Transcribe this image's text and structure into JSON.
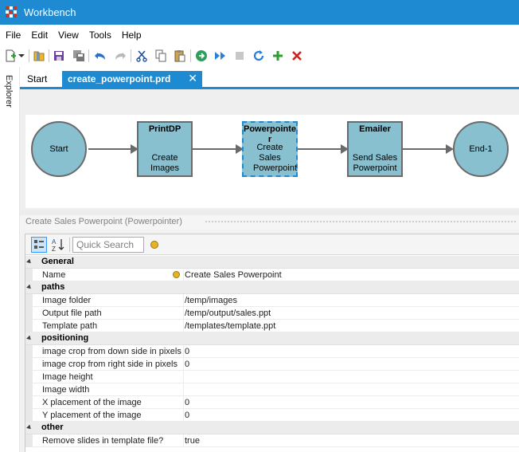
{
  "window": {
    "title": "Workbench"
  },
  "menu": {
    "items": [
      "File",
      "Edit",
      "View",
      "Tools",
      "Help"
    ]
  },
  "toolbar": {
    "icons": [
      "new-icon",
      "dropdown-arrow-icon",
      "open-folder-icon",
      "save-icon",
      "save-all-icon",
      "undo-icon",
      "redo-icon",
      "cut-icon",
      "copy-icon",
      "paste-icon",
      "run-icon",
      "fast-forward-icon",
      "stop-icon",
      "refresh-icon",
      "add-icon",
      "delete-icon"
    ]
  },
  "explorer": {
    "label": "Explorer"
  },
  "tabs": [
    {
      "label": "Start",
      "active": false
    },
    {
      "label": "create_powerpoint.prd",
      "active": true,
      "close": "✕"
    }
  ],
  "diagram": {
    "nodes": [
      {
        "id": "start",
        "shape": "circle",
        "label": "Start"
      },
      {
        "id": "printdp",
        "shape": "box",
        "title": "PrintDP",
        "description": "Create Images"
      },
      {
        "id": "powerpointer",
        "shape": "box",
        "title": "Powerpointer",
        "description": "Create Sales Powerpoint",
        "selected": true
      },
      {
        "id": "emailer",
        "shape": "box",
        "title": "Emailer",
        "description": "Send Sales Powerpoint"
      },
      {
        "id": "end",
        "shape": "circle",
        "label": "End-1"
      }
    ],
    "edges": [
      [
        "start",
        "printdp"
      ],
      [
        "printdp",
        "powerpointer"
      ],
      [
        "powerpointer",
        "emailer"
      ],
      [
        "emailer",
        "end"
      ]
    ],
    "node_color": "#88c0d0",
    "selection_color": "#1e8ad2"
  },
  "properties": {
    "panel_title": "Create Sales Powerpoint (Powerpointer)",
    "search_placeholder": "Quick Search",
    "categories": [
      {
        "name": "General",
        "rows": [
          {
            "name": "Name",
            "value": "Create Sales Powerpoint",
            "icon": "info-icon"
          }
        ]
      },
      {
        "name": "paths",
        "rows": [
          {
            "name": "Image folder",
            "value": "/temp/images"
          },
          {
            "name": "Output file path",
            "value": "/temp/output/sales.ppt"
          },
          {
            "name": "Template path",
            "value": "/templates/template.ppt"
          }
        ]
      },
      {
        "name": "positioning",
        "rows": [
          {
            "name": "image crop from down side in pixels",
            "value": "0"
          },
          {
            "name": "image crop from right side in pixels",
            "value": "0"
          },
          {
            "name": "Image height",
            "value": ""
          },
          {
            "name": "Image width",
            "value": ""
          },
          {
            "name": "X placement of the image",
            "value": "0"
          },
          {
            "name": "Y placement of the image",
            "value": "0"
          }
        ]
      },
      {
        "name": "other",
        "rows": [
          {
            "name": "Remove slides in template file?",
            "value": "true"
          }
        ]
      }
    ]
  },
  "colors": {
    "accent": "#1e8ad2",
    "app_icon": "#c0392b"
  }
}
